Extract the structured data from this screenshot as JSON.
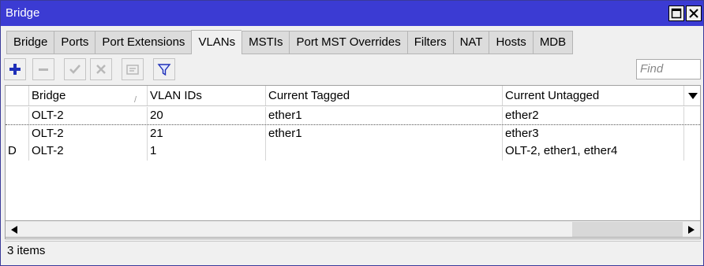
{
  "window": {
    "title": "Bridge"
  },
  "tabs": [
    {
      "label": "Bridge"
    },
    {
      "label": "Ports"
    },
    {
      "label": "Port Extensions"
    },
    {
      "label": "VLANs"
    },
    {
      "label": "MSTIs"
    },
    {
      "label": "Port MST Overrides"
    },
    {
      "label": "Filters"
    },
    {
      "label": "NAT"
    },
    {
      "label": "Hosts"
    },
    {
      "label": "MDB"
    }
  ],
  "active_tab": "VLANs",
  "toolbar": {
    "add_icon": "plus-icon",
    "remove_icon": "minus-icon",
    "enable_icon": "check-icon",
    "disable_icon": "cross-icon",
    "comment_icon": "note-icon",
    "filter_icon": "funnel-icon",
    "find_placeholder": "Find"
  },
  "table": {
    "columns": [
      "",
      "Bridge",
      "VLAN IDs",
      "Current Tagged",
      "Current Untagged"
    ],
    "rows": [
      {
        "flag": "",
        "bridge": "OLT-2",
        "vlan_ids": "20",
        "tagged": "ether1",
        "untagged": "ether2"
      },
      {
        "flag": "",
        "bridge": "OLT-2",
        "vlan_ids": "21",
        "tagged": "ether1",
        "untagged": "ether3"
      },
      {
        "flag": "D",
        "bridge": "OLT-2",
        "vlan_ids": "1",
        "tagged": "",
        "untagged": "OLT-2, ether1, ether4"
      }
    ]
  },
  "status": {
    "count_text": "3 items"
  },
  "colors": {
    "titlebar": "#3b3bd3",
    "add_icon": "#1e2fb8"
  }
}
